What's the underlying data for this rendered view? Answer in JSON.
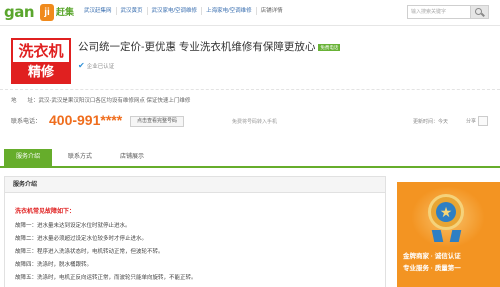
{
  "header": {
    "logo": {
      "text": "gan",
      "badge": "ji",
      "sub": "赶集"
    },
    "breadcrumbs": [
      "武汉赶集网",
      "武汉黄页",
      "武汉家电/空调维修",
      "上海家电/空调维修",
      "店铺详情"
    ],
    "search": {
      "placeholder": "输入搜索关键字"
    }
  },
  "shop": {
    "logo_top": "洗衣机",
    "logo_bottom": "精修",
    "title": "公司统一定价-更优惠 专业洗衣机维修有保障更放心",
    "tag": "免费电话",
    "verified": "企业已认证"
  },
  "info": {
    "address": "地　　址：武汉-武汉是果汉阳汉口各区均设有维修网点 保证快速上门维修",
    "phone_label": "联系电话：",
    "phone": "400-991****",
    "view_button": "点击查看完整号码",
    "disclaimer": "免费将号码转入手机",
    "updated": "更新时间：今天",
    "share": "分享"
  },
  "tabs": [
    {
      "label": "服务介绍",
      "active": true
    },
    {
      "label": "联系方式",
      "active": false
    },
    {
      "label": "店铺展示",
      "active": false
    }
  ],
  "main": {
    "panel_title": "服务介绍",
    "faults_title": "洗衣机常见故障如下：",
    "faults": [
      "故障一：进水量未达到设定水位时就停止进水。",
      "故障二：进水量必须超过设定水位较多时才停止进水。",
      "故障三：程序进入洗涤状态时，电机转动正常，但波轮不转。",
      "故障四：洗涤时，脱水桶跟转。",
      "故障五：洗涤时，电机正反向运转正常，而波轮只能单向旋转，不能正转。"
    ]
  },
  "ad": {
    "line1": "金牌商家 · 诚信认证",
    "line2": "专业服务 · 质量第一"
  }
}
